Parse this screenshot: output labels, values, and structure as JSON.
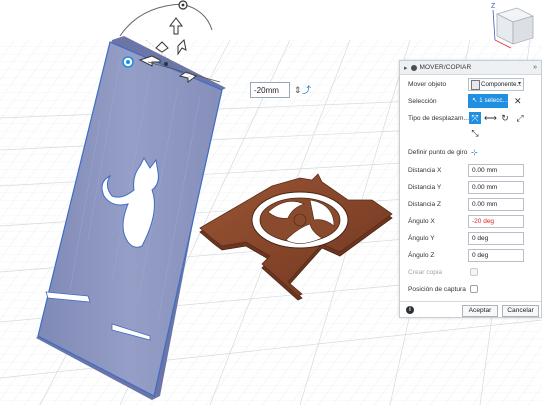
{
  "viewport": {
    "distance_value": "-20mm",
    "icons": [
      "ruler-icon",
      "export-arrow-icon"
    ]
  },
  "viewcube": {
    "face_label": "FRONT",
    "axis_z": "Z"
  },
  "panel": {
    "title": "MOVER/COPIAR",
    "move_object_label": "Mover objeto",
    "move_object_value": "Componente...",
    "selection_label": "Selección",
    "selection_value": "1 selecc...",
    "move_type_label": "Tipo de desplazam...",
    "pivot_label": "Definir punto de giro",
    "distance_x_label": "Distancia X",
    "distance_x_value": "0.00 mm",
    "distance_y_label": "Distancia Y",
    "distance_y_value": "0.00 mm",
    "distance_z_label": "Distancia Z",
    "distance_z_value": "0.00 mm",
    "angle_x_label": "Ángulo X",
    "angle_x_value": "-20 deg",
    "angle_y_label": "Ángulo Y",
    "angle_y_value": "0 deg",
    "angle_z_label": "Ángulo Z",
    "angle_z_value": "0 deg",
    "create_copy_label": "Crear copia",
    "capture_position_label": "Posición de captura",
    "ok_label": "Aceptar",
    "cancel_label": "Cancelar"
  },
  "colors": {
    "accent": "#1f8fe0",
    "body_blue": "#8f98c2",
    "wood": "#8a4a2e",
    "angle_red": "#e02020"
  }
}
